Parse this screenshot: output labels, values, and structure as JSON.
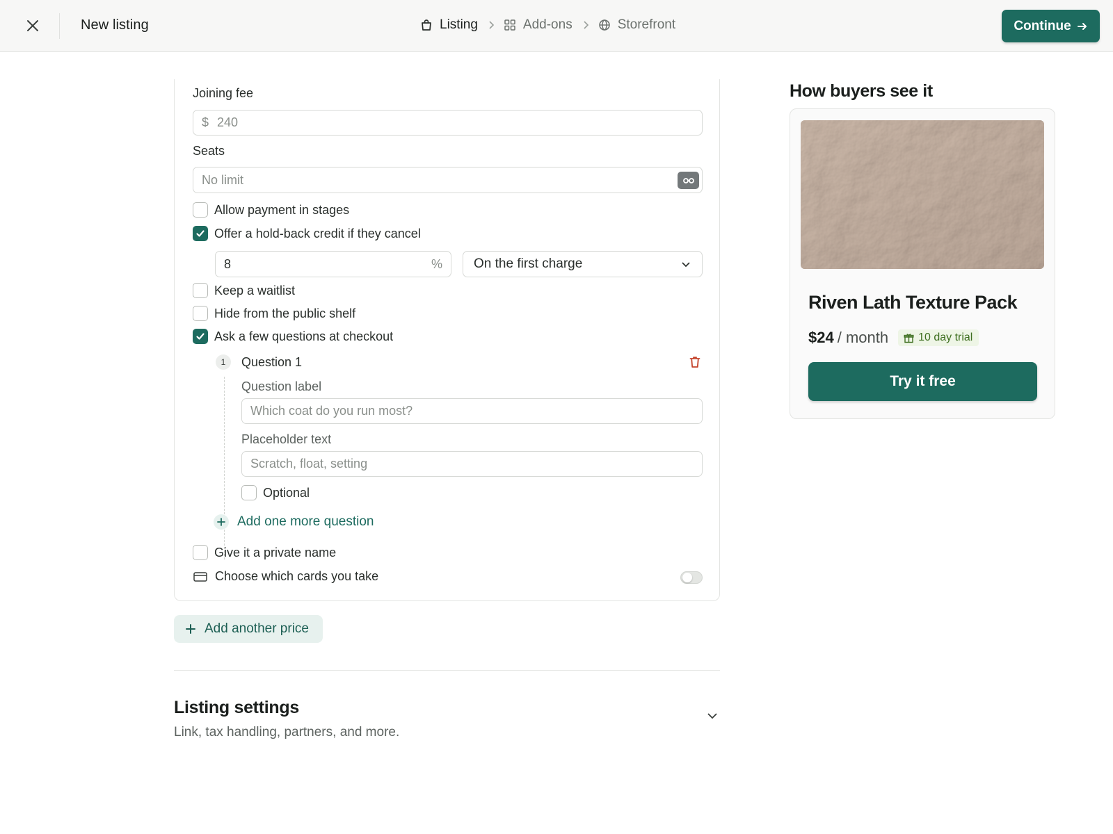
{
  "header": {
    "title": "New listing",
    "steps": [
      {
        "label": "Listing",
        "icon": "shopping-bag-icon",
        "active": true
      },
      {
        "label": "Add-ons",
        "icon": "grid-icon",
        "active": false
      },
      {
        "label": "Storefront",
        "icon": "globe-icon",
        "active": false
      }
    ],
    "continue_label": "Continue"
  },
  "form": {
    "joining_fee": {
      "label": "Joining fee",
      "currency": "$",
      "placeholder": "240"
    },
    "seats": {
      "label": "Seats",
      "placeholder": "No limit"
    },
    "options": [
      {
        "label": "Allow payment in stages",
        "checked": false
      },
      {
        "label": "Offer a hold-back credit if they cancel",
        "checked": true
      },
      {
        "label": "Keep a waitlist",
        "checked": false
      },
      {
        "label": "Hide from the public shelf",
        "checked": false
      },
      {
        "label": "Ask a few questions at checkout",
        "checked": true
      },
      {
        "label": "Give it a private name",
        "checked": false
      }
    ],
    "holdback": {
      "value": "8",
      "unit": "%",
      "timing": "On the first charge"
    },
    "question": {
      "number": "1",
      "title": "Question 1",
      "label_field": {
        "label": "Question label",
        "placeholder": "Which coat do you run most?"
      },
      "placeholder_field": {
        "label": "Placeholder text",
        "placeholder": "Scratch, float, setting"
      },
      "optional_label": "Optional"
    },
    "add_question_label": "Add one more question",
    "cards": {
      "label": "Choose which cards you take",
      "enabled": false
    },
    "add_price_label": "Add another price"
  },
  "settings": {
    "title": "Listing settings",
    "subtitle": "Link, tax handling, partners, and more."
  },
  "preview": {
    "heading": "How buyers see it",
    "product_name": "Riven Lath Texture Pack",
    "price": "$24",
    "period": "/ month",
    "trial": "10 day trial",
    "cta": "Try it free"
  },
  "colors": {
    "accent": "#1d6b5f",
    "danger": "#c4432b",
    "trial_bg": "#eef5e6"
  }
}
